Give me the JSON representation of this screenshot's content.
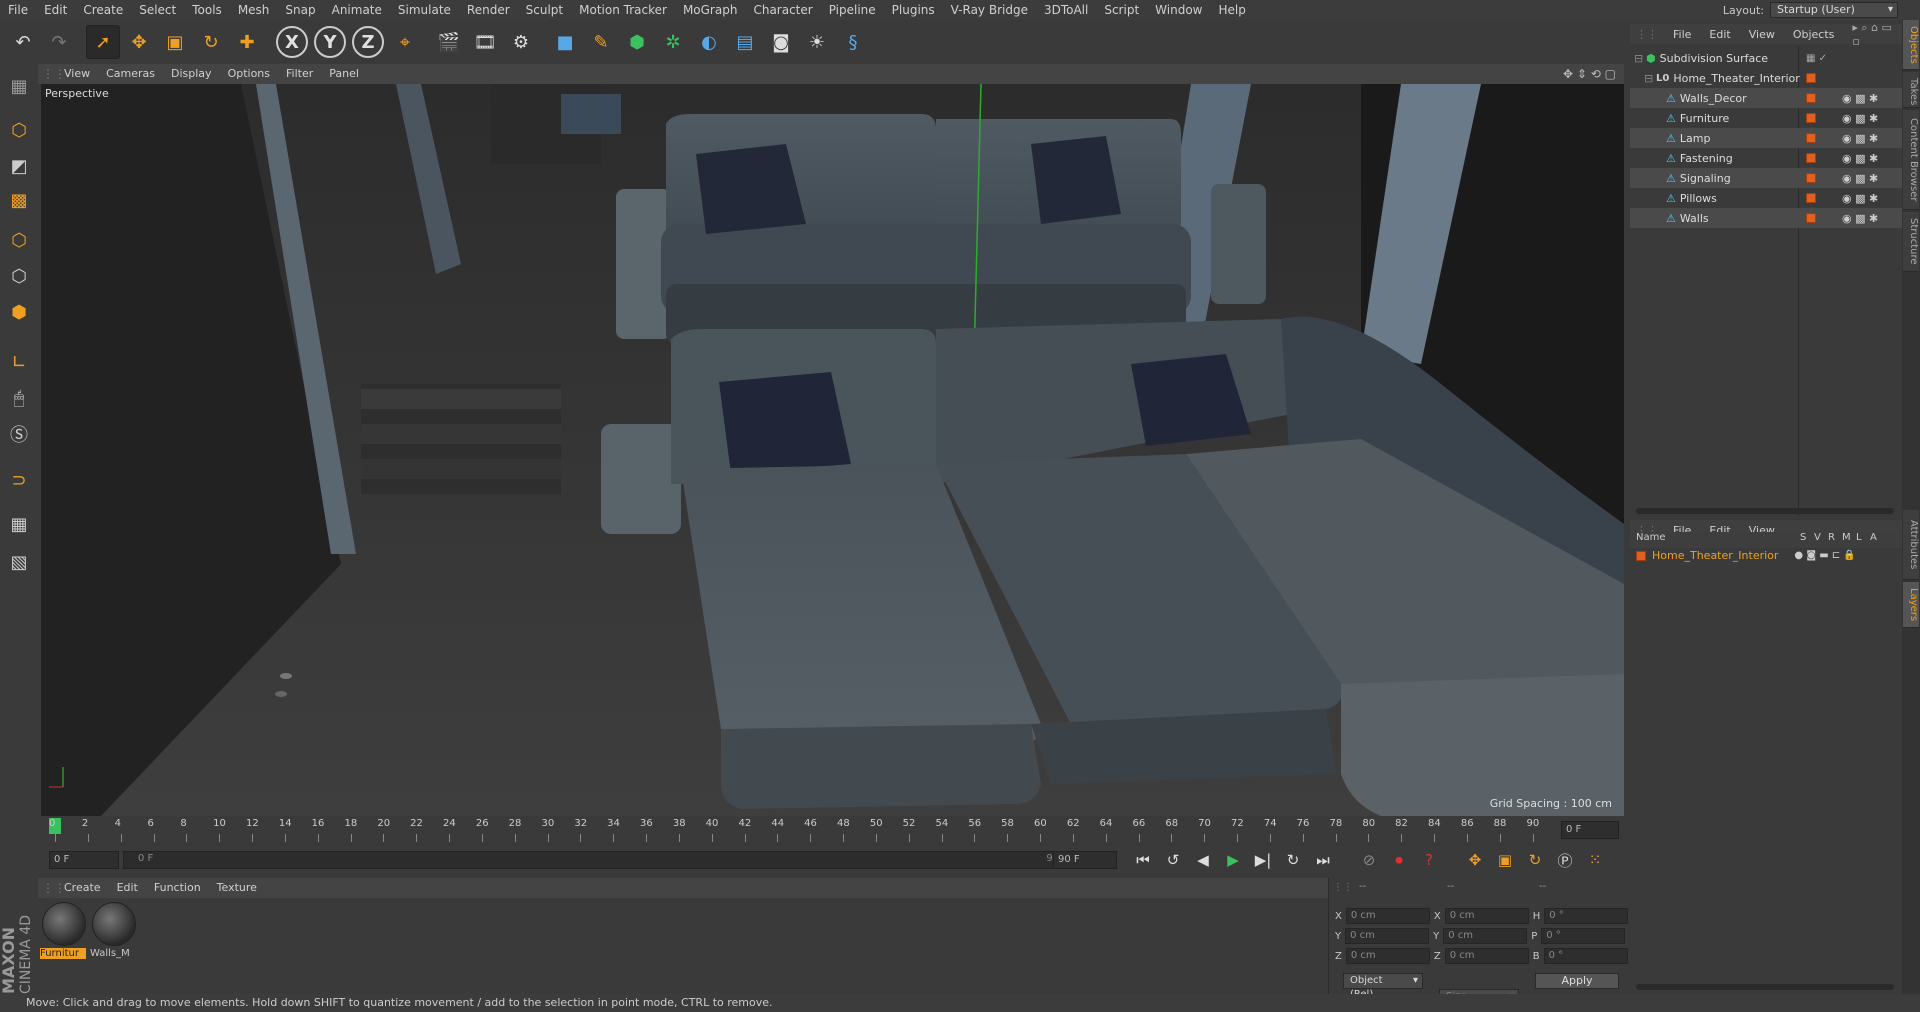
{
  "menubar": {
    "items": [
      "File",
      "Edit",
      "Create",
      "Select",
      "Tools",
      "Mesh",
      "Snap",
      "Animate",
      "Simulate",
      "Render",
      "Sculpt",
      "Motion Tracker",
      "MoGraph",
      "Character",
      "Pipeline",
      "Plugins",
      "V-Ray Bridge",
      "3DToAll",
      "Script",
      "Window",
      "Help"
    ],
    "layout_label": "Layout:",
    "layout_value": "Startup (User)"
  },
  "toolbar": {
    "icons": [
      "undo-icon",
      "redo-icon",
      "select-arrow-icon",
      "move-icon",
      "scale-icon",
      "rotate-icon",
      "live-select-icon",
      "x-axis-lock",
      "y-axis-lock",
      "z-axis-lock",
      "coordinate-system-icon",
      "render-view-icon",
      "render-picture-viewer-icon",
      "edit-render-settings-icon",
      "cube-primitive-icon",
      "pen-spline-icon",
      "subdivision-surface-icon",
      "cloner-icon",
      "deformer-icon",
      "floor-icon",
      "camera-icon",
      "light-icon",
      "python-icon"
    ],
    "x_label": "X",
    "y_label": "Y",
    "z_label": "Z"
  },
  "viewport": {
    "menu": [
      "View",
      "Cameras",
      "Display",
      "Options",
      "Filter",
      "Panel"
    ],
    "label": "Perspective",
    "grid_spacing": "Grid Spacing : 100 cm"
  },
  "timeline": {
    "ticks": [
      "0",
      "2",
      "4",
      "6",
      "8",
      "10",
      "12",
      "14",
      "16",
      "18",
      "20",
      "22",
      "24",
      "26",
      "28",
      "30",
      "32",
      "34",
      "36",
      "38",
      "40",
      "42",
      "44",
      "46",
      "48",
      "50",
      "52",
      "54",
      "56",
      "58",
      "60",
      "62",
      "64",
      "66",
      "68",
      "70",
      "72",
      "74",
      "76",
      "78",
      "80",
      "82",
      "84",
      "86",
      "88",
      "90"
    ],
    "current_frame": "0 F"
  },
  "transport": {
    "start_field": "0 F",
    "range_start": "0 F",
    "range_end": "90 F",
    "end_field": "90 F",
    "end_field2": "90 F"
  },
  "materials": {
    "menu": [
      "Create",
      "Edit",
      "Function",
      "Texture"
    ],
    "items": [
      {
        "label": "Furnitur",
        "selected": true
      },
      {
        "label": "Walls_M",
        "selected": false
      }
    ]
  },
  "coordinates": {
    "header_dashes": [
      "--",
      "--",
      "--"
    ],
    "rows": [
      {
        "a": "X",
        "av": "0 cm",
        "b": "X",
        "bv": "0 cm",
        "c": "H",
        "cv": "0 °"
      },
      {
        "a": "Y",
        "av": "0 cm",
        "b": "Y",
        "bv": "0 cm",
        "c": "P",
        "cv": "0 °"
      },
      {
        "a": "Z",
        "av": "0 cm",
        "b": "Z",
        "bv": "0 cm",
        "c": "B",
        "cv": "0 °"
      }
    ],
    "mode": "Object (Rel)",
    "size": "Size",
    "apply": "Apply"
  },
  "objects_panel": {
    "menu": [
      "File",
      "Edit",
      "View",
      "Objects"
    ],
    "tree": [
      {
        "name": "Subdivision Surface",
        "level": 0
      },
      {
        "name": "Home_Theater_Interior",
        "level": 1
      },
      {
        "name": "Walls_Decor",
        "level": 2
      },
      {
        "name": "Furniture",
        "level": 2
      },
      {
        "name": "Lamp",
        "level": 2
      },
      {
        "name": "Fastening",
        "level": 2
      },
      {
        "name": "Signaling",
        "level": 2
      },
      {
        "name": "Pillows",
        "level": 2
      },
      {
        "name": "Walls",
        "level": 2
      }
    ]
  },
  "layers_panel": {
    "menu": [
      "File",
      "Edit",
      "View"
    ],
    "columns": [
      "Name",
      "S",
      "V",
      "R",
      "M",
      "L",
      "A"
    ],
    "layer": "Home_Theater_Interior"
  },
  "side_tabs": [
    "Objects",
    "Takes",
    "Content Browser",
    "Structure",
    "Attributes",
    "Layers"
  ],
  "status": "Move: Click and drag to move elements. Hold down SHIFT to quantize movement / add to the selection in point mode, CTRL to remove.",
  "branding": {
    "line1": "MAXON",
    "line2": "CINEMA 4D"
  }
}
